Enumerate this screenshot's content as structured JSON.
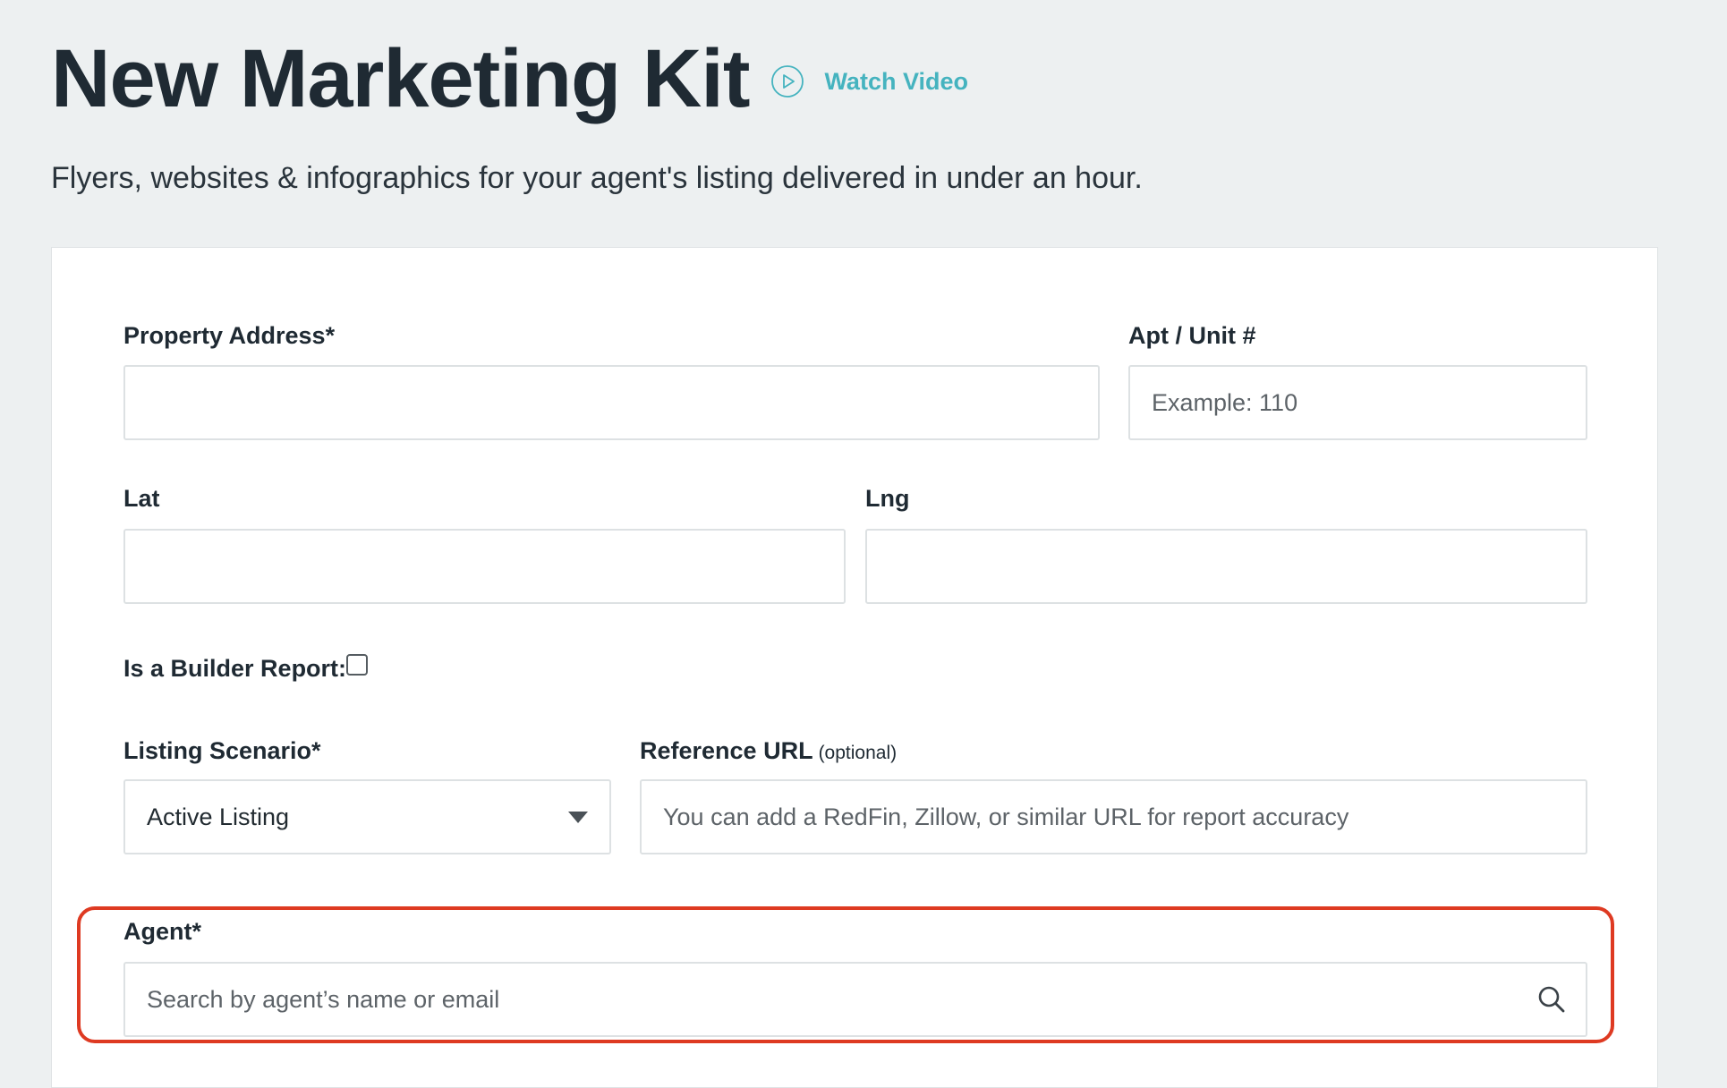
{
  "header": {
    "title": "New Marketing Kit",
    "watch_video_label": "Watch Video",
    "subtitle": "Flyers, websites & infographics for your agent's listing delivered in under an hour."
  },
  "form": {
    "property_address": {
      "label": "Property Address*",
      "value": "",
      "placeholder": ""
    },
    "apt_unit": {
      "label": "Apt / Unit #",
      "value": "",
      "placeholder": "Example: 110"
    },
    "lat": {
      "label": "Lat",
      "value": "",
      "placeholder": ""
    },
    "lng": {
      "label": "Lng",
      "value": "",
      "placeholder": ""
    },
    "builder_report": {
      "label": "Is a Builder Report:",
      "checked": false
    },
    "listing_scenario": {
      "label": "Listing Scenario*",
      "selected": "Active Listing"
    },
    "reference_url": {
      "label": "Reference URL",
      "optional_label": "(optional)",
      "value": "",
      "placeholder": "You can add a RedFin, Zillow, or similar URL for report accuracy"
    },
    "agent": {
      "label": "Agent*",
      "value": "",
      "placeholder": "Search by agent’s name or email"
    }
  },
  "colors": {
    "background": "#edf0f1",
    "accent_teal": "#45b3bf",
    "highlight_red": "#de3a22",
    "title_text": "#1f2a33"
  },
  "icons": {
    "play": "play-circle-icon",
    "dropdown": "chevron-down-icon",
    "search": "search-icon"
  }
}
